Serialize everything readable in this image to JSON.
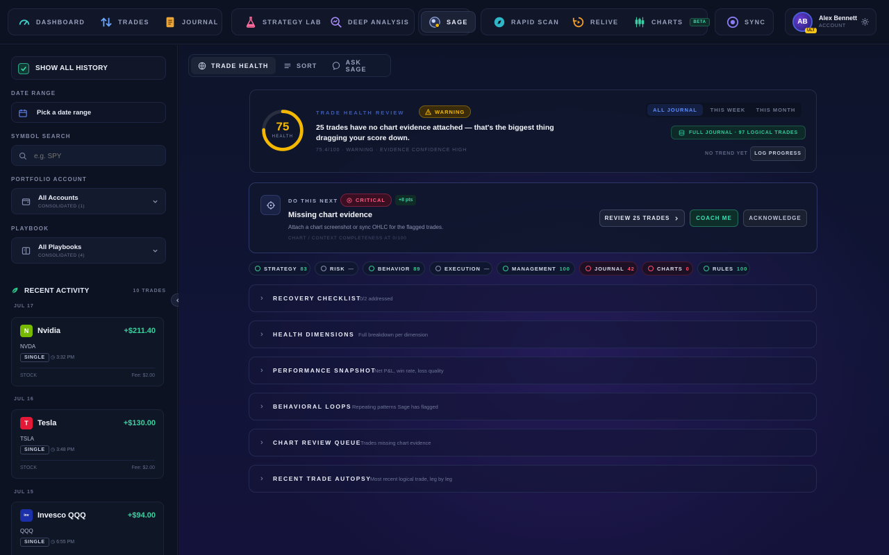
{
  "nav": {
    "groups": [
      {
        "items": [
          {
            "label": "Dashboard",
            "icon": "gauge-icon"
          },
          {
            "label": "Trades",
            "icon": "arrows-updown-icon"
          },
          {
            "label": "Journal",
            "icon": "notebook-icon"
          }
        ]
      },
      {
        "items": [
          {
            "label": "Strategy Lab",
            "icon": "flask-icon"
          },
          {
            "label": "Deep Analysis",
            "icon": "magnifier-chart-icon"
          }
        ]
      },
      {
        "items": [
          {
            "label": "Sage",
            "icon": "sage-orb-icon",
            "active": true
          }
        ]
      },
      {
        "items": [
          {
            "label": "Rapid Scan",
            "icon": "compass-icon"
          },
          {
            "label": "Relive",
            "icon": "replay-icon"
          },
          {
            "label": "Charts",
            "icon": "candles-icon",
            "badge": "BETA"
          }
        ]
      },
      {
        "items": [
          {
            "label": "Sync",
            "icon": "sync-orb-icon"
          }
        ]
      }
    ],
    "user": {
      "initials": "AB",
      "name": "Alex Bennett",
      "role": "ACCOUNT",
      "tier": "ULT"
    }
  },
  "sidebar": {
    "show_history": "SHOW ALL HISTORY",
    "date_range_label": "DATE RANGE",
    "date_range_placeholder": "Pick a date range",
    "symbol_search_label": "SYMBOL SEARCH",
    "symbol_search_placeholder": "e.g. SPY",
    "portfolio_label": "PORTFOLIO ACCOUNT",
    "portfolio_value": "All Accounts",
    "portfolio_sub": "CONSOLIDATED (1)",
    "playbook_label": "PLAYBOOK",
    "playbook_value": "All Playbooks",
    "playbook_sub": "CONSOLIDATED (4)",
    "recent_title": "RECENT ACTIVITY",
    "recent_count": "10 TRADES",
    "days": [
      "JUL 17",
      "JUL 16",
      "JUL 15"
    ],
    "trades": [
      {
        "name": "Nvidia",
        "symbol": "NVDA",
        "pnl": "+$211.40",
        "type": "SINGLE",
        "time": "3:32 PM",
        "asset": "STOCK",
        "fee": "Fee: $2.00",
        "logo_color": "#76b900"
      },
      {
        "name": "Tesla",
        "symbol": "TSLA",
        "pnl": "+$130.00",
        "type": "SINGLE",
        "time": "3:48 PM",
        "asset": "STOCK",
        "fee": "Fee: $2.00",
        "logo_color": "#e31937"
      },
      {
        "name": "Invesco QQQ",
        "symbol": "QQQ",
        "pnl": "+$94.00",
        "type": "SINGLE",
        "time": "6:55 PM",
        "asset": "",
        "fee": "",
        "logo_color": "#1b2fa8"
      }
    ]
  },
  "tabs": [
    {
      "label": "TRADE HEALTH",
      "icon": "globe-icon"
    },
    {
      "label": "SORT",
      "icon": "list-icon"
    },
    {
      "label": "ASK SAGE",
      "icon": "chat-bubble-icon"
    }
  ],
  "health": {
    "score": "75",
    "score_label": "HEALTH",
    "score_value": 75.4,
    "section_label": "TRADE HEALTH REVIEW",
    "status_badge": "WARNING",
    "headline": "25 trades have no chart evidence attached — that's the biggest thing dragging your score down.",
    "meta": "75.4/100 · WARNING · EVIDENCE CONFIDENCE HIGH",
    "period_tabs": [
      "ALL JOURNAL",
      "THIS WEEK",
      "THIS MONTH"
    ],
    "journal_pill": "FULL JOURNAL · 97 LOGICAL TRADES",
    "trend": "NO TREND YET",
    "log_progress": "LOG PROGRESS",
    "ring_color": "#f5b800"
  },
  "next": {
    "label": "DO THIS NEXT",
    "severity": "CRITICAL",
    "points": "+8 pts",
    "title": "Missing chart evidence",
    "desc": "Attach a chart screenshot or sync OHLC for the flagged trades.",
    "meta": "CHART / CONTEXT COMPLETENESS AT 0/100",
    "btn_review": "REVIEW 25 TRADES",
    "btn_coach": "COACH ME",
    "btn_ack": "ACKNOWLEDGE"
  },
  "dimensions": [
    {
      "label": "STRATEGY",
      "value": "83",
      "color": "#35c98f"
    },
    {
      "label": "RISK",
      "value": "—",
      "color": "#8a93b2"
    },
    {
      "label": "BEHAVIOR",
      "value": "89",
      "color": "#35c98f"
    },
    {
      "label": "EXECUTION",
      "value": "—",
      "color": "#8a93b2"
    },
    {
      "label": "MANAGEMENT",
      "value": "100",
      "color": "#35c98f"
    },
    {
      "label": "JOURNAL",
      "value": "42",
      "color": "#ff4d6d"
    },
    {
      "label": "CHARTS",
      "value": "0",
      "color": "#ff4d6d"
    },
    {
      "label": "RULES",
      "value": "100",
      "color": "#35c98f"
    }
  ],
  "sections": [
    {
      "title": "RECOVERY CHECKLIST",
      "sub": "0/2 addressed"
    },
    {
      "title": "HEALTH DIMENSIONS",
      "sub": "Full breakdown per dimension"
    },
    {
      "title": "PERFORMANCE SNAPSHOT",
      "sub": "Net P&L, win rate, loss quality"
    },
    {
      "title": "BEHAVIORAL LOOPS",
      "sub": "Repeating patterns Sage has flagged"
    },
    {
      "title": "CHART REVIEW QUEUE",
      "sub": "Trades missing chart evidence"
    },
    {
      "title": "RECENT TRADE AUTOPSY",
      "sub": "Most recent logical trade, leg by leg"
    }
  ]
}
